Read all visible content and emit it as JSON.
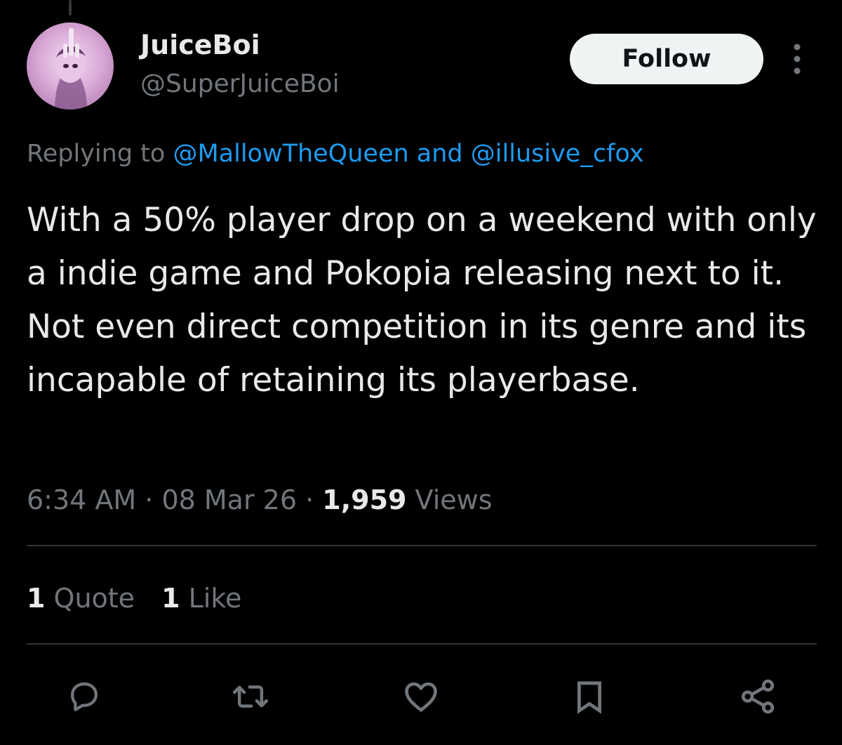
{
  "author": {
    "display_name": "JuiceBoi",
    "handle": "@SuperJuiceBoi",
    "avatar_icon": "avatar-image"
  },
  "follow_label": "Follow",
  "more_icon": "more-vertical-icon",
  "reply": {
    "prefix": "Replying to ",
    "mention_1": "@MallowTheQueen",
    "joiner": " and ",
    "mention_2": "@illusive_cfox"
  },
  "tweet": {
    "text": "With a 50% player drop on a weekend with only a indie game and Pokopia releasing next to it. Not even direct competition in its genre and its incapable of retaining its playerbase."
  },
  "meta": {
    "time": "6:34 AM",
    "separator": " · ",
    "date": "08 Mar 26",
    "views_count": "1,959",
    "views_label": " Views"
  },
  "stats": {
    "quotes_count": "1",
    "quotes_label": " Quote",
    "likes_count": "1",
    "likes_label": " Like"
  },
  "actions": [
    {
      "name": "reply",
      "icon": "reply-icon"
    },
    {
      "name": "repost",
      "icon": "repost-icon"
    },
    {
      "name": "like",
      "icon": "heart-icon"
    },
    {
      "name": "bookmark",
      "icon": "bookmark-icon"
    },
    {
      "name": "share",
      "icon": "share-icon"
    }
  ],
  "colors": {
    "background": "#000000",
    "text_primary": "#e7e9ea",
    "text_secondary": "#71767b",
    "link": "#1d9bf0",
    "divider": "#2f3336",
    "follow_bg": "#eff3f4"
  }
}
